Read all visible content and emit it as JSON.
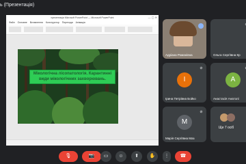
{
  "meeting": {
    "title_fragment": "ь (Презентація)"
  },
  "ppt": {
    "window_title": "презентація Microsoft PowerPoint — Microsoft PowerPoint",
    "window_controls": "— ▢ ✕",
    "tabs": [
      "Файл",
      "Основне",
      "Вставлення",
      "Конструктор",
      "Переходи",
      "Анімація",
      "Показ слайдів",
      "Рецензування",
      "Вигляд"
    ]
  },
  "slide": {
    "text": "Мікологічна лісопатологія. Карантинні види мікологічних захворювань."
  },
  "participants": [
    {
      "name": "Адріана Романівна",
      "type": "video"
    },
    {
      "name": "Ольга Сергіївна Кр",
      "initial": "О",
      "color": "#5f6368",
      "type": "avatar"
    },
    {
      "name": "Ірина Петрівна Бойко",
      "initial": "І",
      "color": "#e8710a",
      "type": "avatar"
    },
    {
      "name": "Анастасія Анатолі",
      "initial": "А",
      "color": "#7cb342",
      "type": "avatar"
    },
    {
      "name": "Марія Сергіївна Маз",
      "initial": "М",
      "color": "#5f6368",
      "type": "avatar"
    },
    {
      "name": "Ще 7 осіб",
      "type": "more"
    }
  ],
  "controls": {
    "mic": "🎙",
    "cam": "📷",
    "cc": "▭",
    "emoji": "☺",
    "present": "⬆",
    "hand": "✋",
    "more": "⋮",
    "leave": "☎"
  },
  "icons": [
    "mic-off-icon",
    "camera-off-icon",
    "captions-icon",
    "emoji-icon",
    "present-icon",
    "raise-hand-icon",
    "more-options-icon",
    "end-call-icon",
    "pin-icon"
  ]
}
